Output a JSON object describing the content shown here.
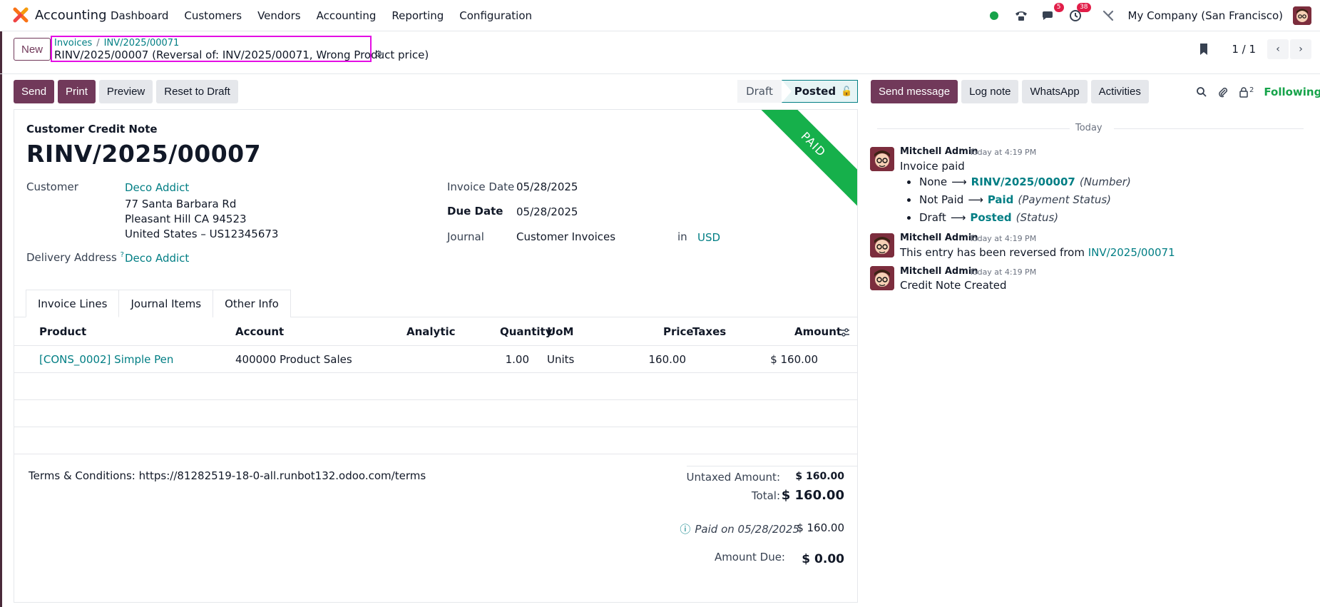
{
  "navbar": {
    "app_name": "Accounting",
    "menu": [
      "Dashboard",
      "Customers",
      "Vendors",
      "Accounting",
      "Reporting",
      "Configuration"
    ],
    "messages_badge": "5",
    "activities_badge": "38",
    "company": "My Company (San Francisco)",
    "status_color": "#16a34a"
  },
  "control": {
    "new_label": "New",
    "breadcrumb": [
      "Invoices",
      "INV/2025/00071"
    ],
    "record_title": "RINV/2025/00007 (Reversal of: INV/2025/00071, Wrong Product price)",
    "pager": "1 / 1"
  },
  "actions": {
    "send": "Send",
    "print": "Print",
    "preview": "Preview",
    "reset": "Reset to Draft"
  },
  "status": {
    "draft": "Draft",
    "posted": "Posted"
  },
  "form": {
    "ribbon": "PAID",
    "doc_type": "Customer Credit Note",
    "doc_name": "RINV/2025/00007",
    "customer_label": "Customer",
    "customer": "Deco Addict",
    "address": [
      "77 Santa Barbara Rd",
      "Pleasant Hill CA 94523",
      "United States – US12345673"
    ],
    "delivery_label": "Delivery Address",
    "delivery_help": "?",
    "delivery": "Deco Addict",
    "invoice_date_label": "Invoice Date",
    "invoice_date": "05/28/2025",
    "due_date_label": "Due Date",
    "due_date": "05/28/2025",
    "journal_label": "Journal",
    "journal": "Customer Invoices",
    "in_label": "in",
    "currency": "USD"
  },
  "tabs": [
    "Invoice Lines",
    "Journal Items",
    "Other Info"
  ],
  "table": {
    "headers": [
      "Product",
      "Account",
      "Analytic",
      "Quantity",
      "UoM",
      "Price",
      "Taxes",
      "Amount"
    ],
    "rows": [
      {
        "product": "[CONS_0002] Simple Pen",
        "account": "400000 Product Sales",
        "analytic": "",
        "quantity": "1.00",
        "uom": "Units",
        "price": "160.00",
        "taxes": "",
        "amount": "$ 160.00"
      }
    ]
  },
  "footer": {
    "terms": "Terms & Conditions: https://81282519-18-0-all.runbot132.odoo.com/terms",
    "untaxed_label": "Untaxed Amount:",
    "untaxed": "$ 160.00",
    "total_label": "Total:",
    "total": "$ 160.00",
    "paid_on": "Paid on 05/28/2025",
    "paid_amount": "$ 160.00",
    "due_label": "Amount Due:",
    "due": "$ 0.00"
  },
  "chatter": {
    "send_message": "Send message",
    "log_note": "Log note",
    "whatsapp": "WhatsApp",
    "activities": "Activities",
    "followers_count": "2",
    "following": "Following",
    "today": "Today",
    "messages": [
      {
        "author": "Mitchell Admin",
        "time": "Today at 4:19 PM",
        "body": "Invoice paid",
        "tracking": [
          {
            "old": "None",
            "new": "RINV/2025/00007",
            "field": "(Number)"
          },
          {
            "old": "Not Paid",
            "new": "Paid",
            "field": "(Payment Status)"
          },
          {
            "old": "Draft",
            "new": "Posted",
            "field": "(Status)"
          }
        ]
      },
      {
        "author": "Mitchell Admin",
        "time": "Today at 4:19 PM",
        "body": "This entry has been reversed from ",
        "link": "INV/2025/00071"
      },
      {
        "author": "Mitchell Admin",
        "time": "Today at 4:19 PM",
        "body": "Credit Note Created"
      }
    ]
  }
}
